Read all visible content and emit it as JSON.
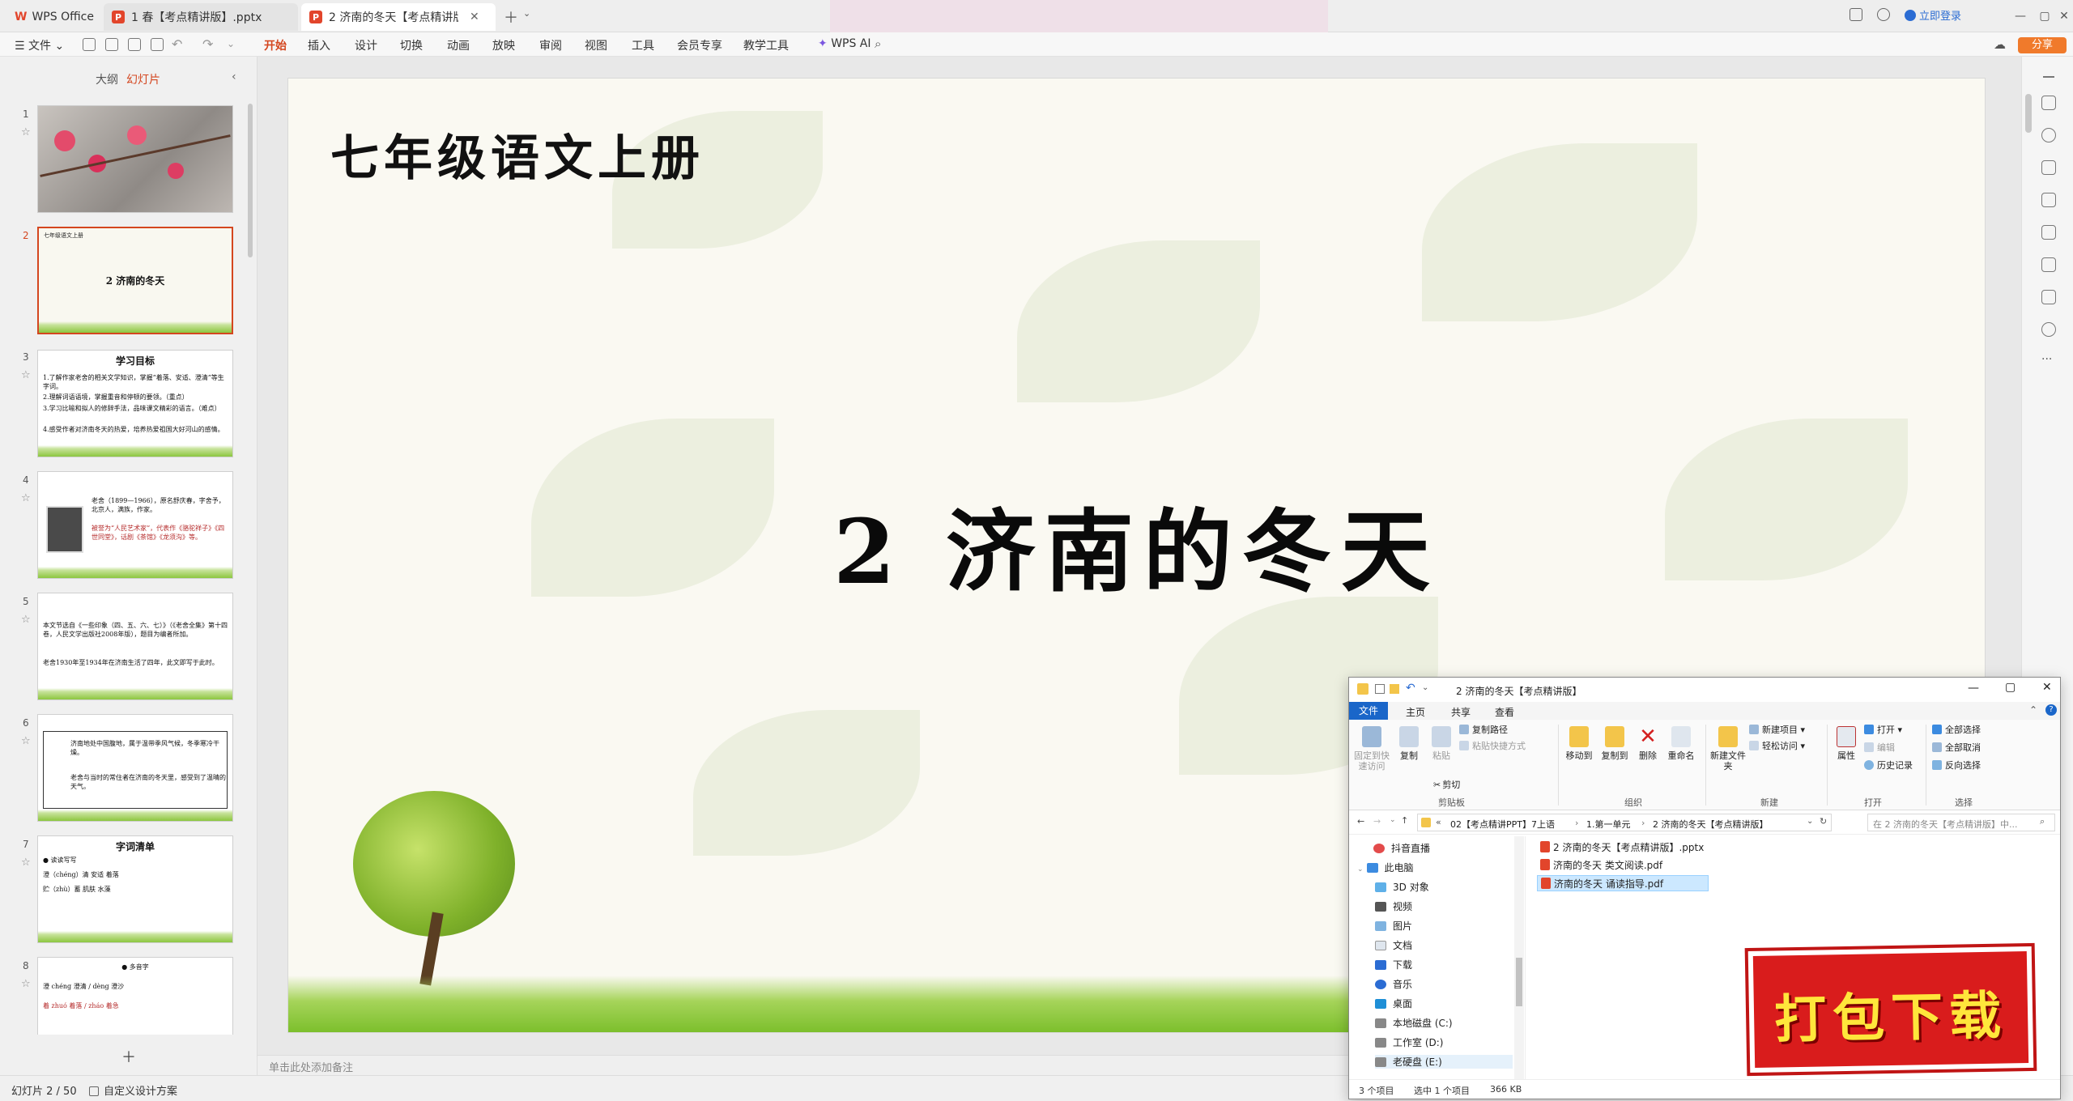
{
  "app": {
    "name": "WPS Office",
    "tabs": [
      {
        "label": "1 春【考点精讲版】.pptx",
        "active": false
      },
      {
        "label": "2 济南的冬天【考点精讲版】",
        "active": true
      }
    ],
    "login": "立即登录",
    "share": "分享"
  },
  "menu": {
    "file": "文件",
    "items": [
      "开始",
      "插入",
      "设计",
      "切换",
      "动画",
      "放映",
      "审阅",
      "视图",
      "工具",
      "会员专享",
      "教学工具"
    ],
    "active": "开始",
    "ai": "WPS AI"
  },
  "panel": {
    "tabs": [
      "大纲",
      "幻灯片"
    ],
    "active_tab": "幻灯片",
    "slides": [
      {
        "num": "1"
      },
      {
        "num": "2",
        "header": "七年级语文上册",
        "title": "2 济南的冬天"
      },
      {
        "num": "3",
        "title": "学习目标",
        "lines": [
          "1.了解作家老舍的相关文学知识，掌握“着落、安适、澄清”等生字词。",
          "2.理解词语语境，掌握重音和停顿的要领。（重点）",
          "3.学习比喻和拟人的修辞手法，品味课文精彩的语言。（难点）",
          "4.感受作者对济南冬天的热爱，培养热爱祖国大好河山的感情。"
        ]
      },
      {
        "num": "4",
        "lines": [
          "老舍（1899—1966），原名舒庆春，字舍予，北京人，满族，作家。",
          "被誉为“人民艺术家”，代表作《骆驼祥子》《四世同堂》，话剧《茶馆》《龙须沟》等。"
        ]
      },
      {
        "num": "5",
        "lines": [
          "本文节选自《一些印象（四、五、六、七）》（《老舍全集》第十四卷，人民文学出版社2008年版），题目为编者所加。",
          "老舍1930年至1934年在济南生活了四年，此文即写于此时。"
        ]
      },
      {
        "num": "6",
        "lines": [
          "济南地处中国腹地，属于温带季风气候，冬季寒冷干燥。",
          "老舍与当时的常住者在济南的冬天里，感受到了温晴的天气。"
        ]
      },
      {
        "num": "7",
        "title": "字词清单",
        "lines": [
          "● 读读写写",
          "澄（chéng）清 安适 着落",
          "贮（zhù）蓄 肌肤 水藻"
        ]
      },
      {
        "num": "8",
        "lines": [
          "● 多音字",
          "澄 chéng 澄清 / dèng 澄沙",
          "着 zhuó 着落 / zháo 着急"
        ]
      }
    ],
    "selected": "2"
  },
  "slide": {
    "header": "七年级语文上册",
    "title": "2  济南的冬天"
  },
  "notes_placeholder": "单击此处添加备注",
  "status": {
    "slide_count": "幻灯片 2 / 50",
    "design": "自定义设计方案"
  },
  "explorer": {
    "title": "2 济南的冬天【考点精讲版】",
    "ribbon_tabs": [
      "文件",
      "主页",
      "共享",
      "查看"
    ],
    "groups": {
      "clipboard": {
        "label": "剪贴板",
        "pin": "固定到快速访问",
        "copy": "复制",
        "paste": "粘贴",
        "copy_path": "复制路径",
        "paste_shortcut": "粘贴快捷方式",
        "cut": "剪切"
      },
      "organize": {
        "label": "组织",
        "move_to": "移动到",
        "copy_to": "复制到",
        "delete": "删除",
        "rename": "重命名"
      },
      "new": {
        "label": "新建",
        "new_folder": "新建文件夹",
        "new_item": "新建项目",
        "easy_access": "轻松访问"
      },
      "open": {
        "label": "打开",
        "properties": "属性",
        "open": "打开",
        "edit": "编辑",
        "history": "历史记录"
      },
      "select": {
        "label": "选择",
        "select_all": "全部选择",
        "select_none": "全部取消",
        "invert": "反向选择"
      }
    },
    "path": [
      "02【考点精讲PPT】7上语",
      "1.第一单元",
      "2 济南的冬天【考点精讲版】"
    ],
    "search_placeholder": "在 2 济南的冬天【考点精讲版】中...",
    "nav": [
      "抖音直播",
      "此电脑",
      "3D 对象",
      "视频",
      "图片",
      "文档",
      "下载",
      "音乐",
      "桌面",
      "本地磁盘 (C:)",
      "工作室 (D:)",
      "老硬盘 (E:)"
    ],
    "files": [
      {
        "name": "2 济南的冬天【考点精讲版】.pptx",
        "selected": false
      },
      {
        "name": "济南的冬天 类文阅读.pdf",
        "selected": false
      },
      {
        "name": "济南的冬天 诵读指导.pdf",
        "selected": true
      }
    ],
    "status": {
      "count": "3 个项目",
      "selected": "选中 1 个项目",
      "size": "366 KB"
    }
  },
  "badge": "打包下载",
  "colors": {
    "accent": "#d4461f",
    "badge_bg": "#d91c1c",
    "badge_text": "#ffe63b"
  }
}
